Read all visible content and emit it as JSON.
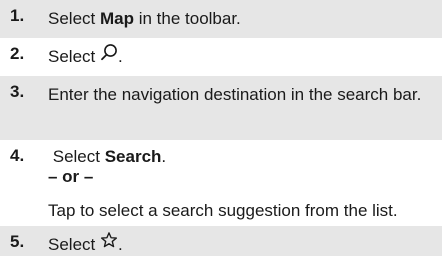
{
  "steps": [
    {
      "number": "1.",
      "prefix": "Select ",
      "bold": "Map",
      "suffix": " in the toolbar."
    },
    {
      "number": "2.",
      "prefix": "Select ",
      "icon": "search-icon",
      "suffix": "."
    },
    {
      "number": "3.",
      "text": "Enter the navigation destination in the search bar."
    },
    {
      "number": "4.",
      "prefix": "Select ",
      "bold": "Search",
      "suffix": ".",
      "or_label": "– or –",
      "alt_text": "Tap to select a search suggestion from the list."
    },
    {
      "number": "5.",
      "prefix": "Select ",
      "icon": "star-icon",
      "suffix": "."
    }
  ],
  "colors": {
    "shaded_row": "#e6e6e6",
    "text": "#1a1a1a"
  }
}
